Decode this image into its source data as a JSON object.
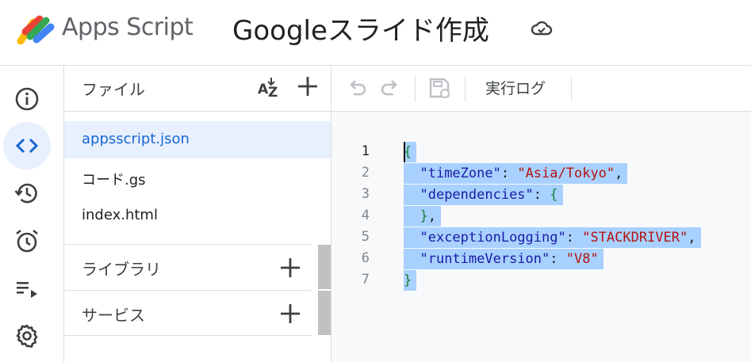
{
  "header": {
    "app_name": "Apps Script",
    "project_title": "Googleスライド作成"
  },
  "rail": {
    "items": [
      {
        "name": "overview",
        "icon": "info-icon"
      },
      {
        "name": "editor",
        "icon": "code-icon",
        "active": true
      },
      {
        "name": "executions",
        "icon": "history-icon"
      },
      {
        "name": "triggers",
        "icon": "alarm-clock-icon"
      },
      {
        "name": "executions-list",
        "icon": "playlist-play-icon"
      },
      {
        "name": "settings",
        "icon": "gear-icon"
      }
    ]
  },
  "files": {
    "title": "ファイル",
    "items": [
      {
        "label": "appsscript.json",
        "selected": true
      },
      {
        "label": "コード.gs",
        "selected": false
      },
      {
        "label": "index.html",
        "selected": false
      }
    ],
    "libraries_label": "ライブラリ",
    "services_label": "サービス"
  },
  "toolbar": {
    "exec_log_label": "実行ログ"
  },
  "editor": {
    "line_numbers": [
      "1",
      "2",
      "3",
      "4",
      "5",
      "6",
      "7"
    ],
    "lines": [
      {
        "indent": "",
        "key": "",
        "value": "",
        "text": "{"
      },
      {
        "indent": "··",
        "key": "\"timeZone\"",
        "sep": ": ",
        "value": "\"Asia/Tokyo\"",
        "tail": ","
      },
      {
        "indent": "··",
        "key": "\"dependencies\"",
        "sep": ": ",
        "value": "{",
        "tail": ""
      },
      {
        "indent": "··",
        "key": "",
        "sep": "",
        "value": "}",
        "tail": ","
      },
      {
        "indent": "··",
        "key": "\"exceptionLogging\"",
        "sep": ": ",
        "value": "\"STACKDRIVER\"",
        "tail": ","
      },
      {
        "indent": "··",
        "key": "\"runtimeVersion\"",
        "sep": ": ",
        "value": "\"V8\"",
        "tail": ""
      },
      {
        "indent": "",
        "key": "",
        "value": "",
        "text": "}"
      }
    ]
  },
  "colors": {
    "accent": "#1967d2",
    "selection": "#a8d1ff",
    "active_bg": "#e8f0fe"
  }
}
